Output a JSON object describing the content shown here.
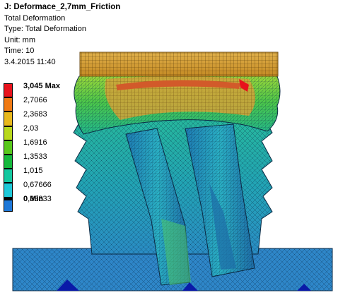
{
  "info": {
    "title": "J: Deformace_2,7mm_Friction",
    "result_name": "Total Deformation",
    "type": "Type: Total Deformation",
    "unit": "Unit: mm",
    "time": "Time: 10",
    "date": "3.4.2015 11:40"
  },
  "legend": {
    "levels": [
      {
        "label": "3,045 Max",
        "color": "#e8131c"
      },
      {
        "label": "2,7066",
        "color": "#f07a14"
      },
      {
        "label": "2,3683",
        "color": "#e8b81c"
      },
      {
        "label": "2,03",
        "color": "#b8d81c"
      },
      {
        "label": "1,6916",
        "color": "#58c81c"
      },
      {
        "label": "1,3533",
        "color": "#14b83c"
      },
      {
        "label": "1,015",
        "color": "#14c8a0"
      },
      {
        "label": "0,67666",
        "color": "#1ec8d8"
      },
      {
        "label": "0,33833",
        "color": "#1e78d8"
      },
      {
        "label": "0 Min",
        "color": "#0000c8"
      }
    ]
  },
  "model": {
    "colors": {
      "cap": "#d7a33c",
      "cap_line": "#6b4a10",
      "upper_body": "#7ad24a",
      "upper_body_2": "#3cc35a",
      "hot_band": "#d25a2a",
      "warm": "#e8a43a",
      "mid": "#22b88a",
      "cool": "#24b4c8",
      "post": "#2aa0b8",
      "post_dark": "#1d6fa8",
      "base": "#2e86c8",
      "base_dark": "#1a5ca8",
      "deep": "#0a1aa8",
      "mesh": "#0b2a44"
    }
  }
}
